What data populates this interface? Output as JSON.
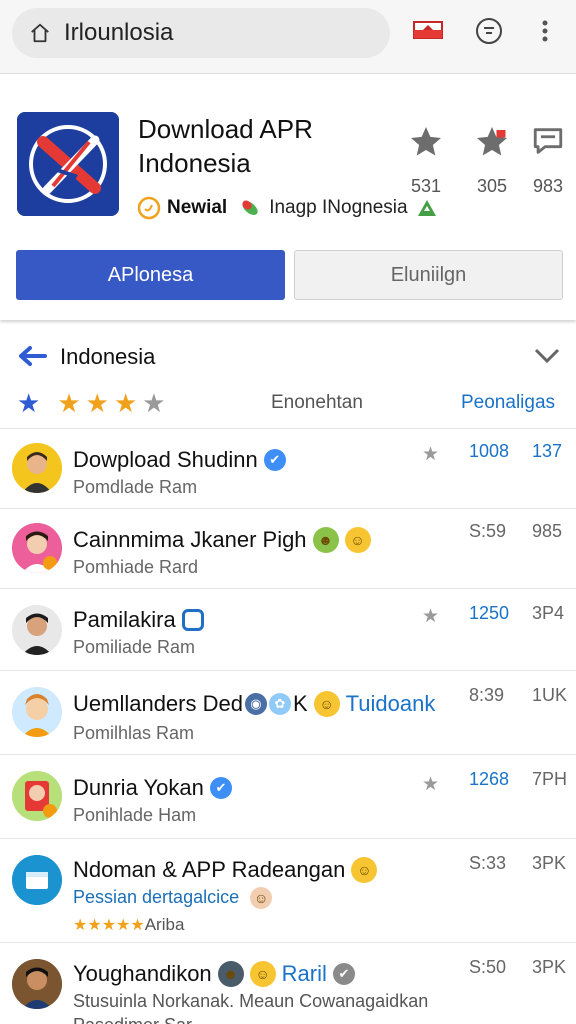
{
  "browser": {
    "url_text": "Irlounlosia"
  },
  "app": {
    "title": "Download APR Indonesia",
    "tag_primary": "Newial",
    "tag_secondary": "Inagp INognesia",
    "stats": [
      {
        "icon": "star-icon",
        "value": "531"
      },
      {
        "icon": "star-flag-icon",
        "value": "305"
      },
      {
        "icon": "comment-icon",
        "value": "983"
      }
    ],
    "primary_button": "APlonesa",
    "secondary_button": "Eluniilgn"
  },
  "section": {
    "title": "Indonesia",
    "filled_stars": 4,
    "sort_label": "Enonehtan",
    "sort_link": "Peonaligas"
  },
  "list": [
    {
      "title": "Dowpload Shudinn",
      "subtitle": "Pomdlade Ram",
      "n1": "1008",
      "n2": "137",
      "n1_color": "blue",
      "n2_color": "blue",
      "star": true
    },
    {
      "title": "Cainnmima Jkaner Pigh",
      "subtitle": "Pomhiade Rard",
      "n1": "S:59",
      "n2": "985",
      "n1_color": "grey",
      "n2_color": "grey",
      "star": false
    },
    {
      "title": "Pamilakira",
      "subtitle": "Pomiliade Ram",
      "n1": "1250",
      "n2": "3P4",
      "n1_color": "blue",
      "n2_color": "grey",
      "star": true
    },
    {
      "title": "Uemllanders Ded",
      "title_extra_letter": "K",
      "title_link": "Tuidoank",
      "subtitle": "Pomilhlas Ram",
      "n1": "8:39",
      "n2": "1UK",
      "n1_color": "grey",
      "n2_color": "grey",
      "star": false
    },
    {
      "title": "Dunria Yokan",
      "subtitle": "Ponihlade Ham",
      "n1": "1268",
      "n2": "7PH",
      "n1_color": "blue",
      "n2_color": "grey",
      "star": true
    },
    {
      "title": "Ndoman & APP Radeangan",
      "subtitle": "Pessian dertagalcice",
      "rating_label": "Ariba",
      "n1": "S:33",
      "n2": "3PK",
      "n1_color": "grey",
      "n2_color": "grey",
      "star": false
    },
    {
      "title": "Youghandikon",
      "title_link": "Raril",
      "subtitle": "Stusuinla Norkanak. Meaun Cowanagaidkan",
      "subtitle_tail": "Pasedimer Sar",
      "n1": "S:50",
      "n2": "3PK",
      "n1_color": "grey",
      "n2_color": "grey",
      "star": false
    }
  ],
  "colors": {
    "accent": "#3759c6",
    "link": "#1a73c8",
    "star_gold": "#f0a21c",
    "star_blue": "#2f5bd3"
  }
}
